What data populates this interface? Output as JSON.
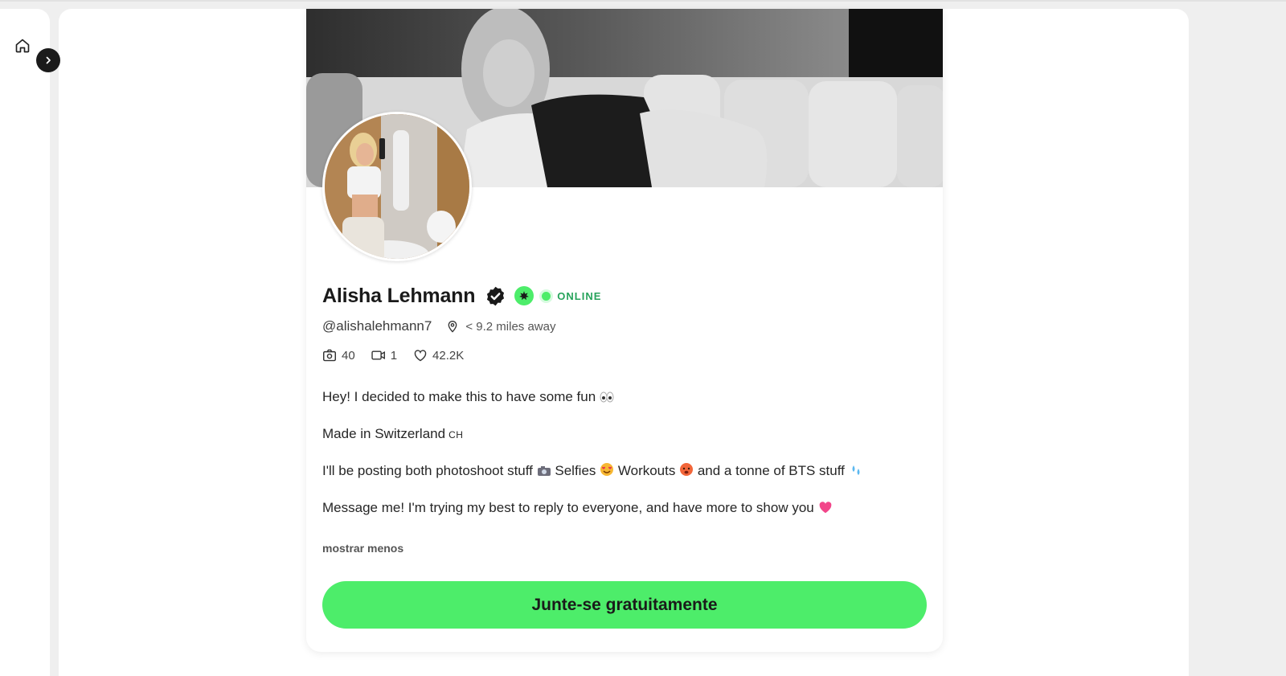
{
  "profile": {
    "name": "Alisha Lehmann",
    "status": "ONLINE",
    "handle": "@alishalehmann7",
    "distance": "< 9.2 miles away"
  },
  "stats": {
    "photos": "40",
    "videos": "1",
    "likes": "42.2K"
  },
  "bio": {
    "line1": "Hey! I decided to make this to have some fun",
    "line2": "Made in Switzerland",
    "line2_flag": "CH",
    "line3_a": "I'll be posting both photoshoot stuff",
    "line3_b": "Selfies",
    "line3_c": "Workouts",
    "line3_d": "and a tonne of BTS stuff",
    "line4": "Message me! I'm trying my best to reply to everyone, and have more to show you"
  },
  "show_less_label": "mostrar menos",
  "join_button_label": "Junte-se gratuitamente",
  "colors": {
    "accent_green": "#4ded6a",
    "online_text": "#27a35b",
    "page_bg": "#efefef",
    "dark_button": "#1b1b1b"
  },
  "icons": [
    "home-icon",
    "chevron-right-icon",
    "verified-check-icon",
    "creator-badge-icon",
    "location-pin-icon",
    "camera-icon",
    "video-icon",
    "heart-icon"
  ]
}
